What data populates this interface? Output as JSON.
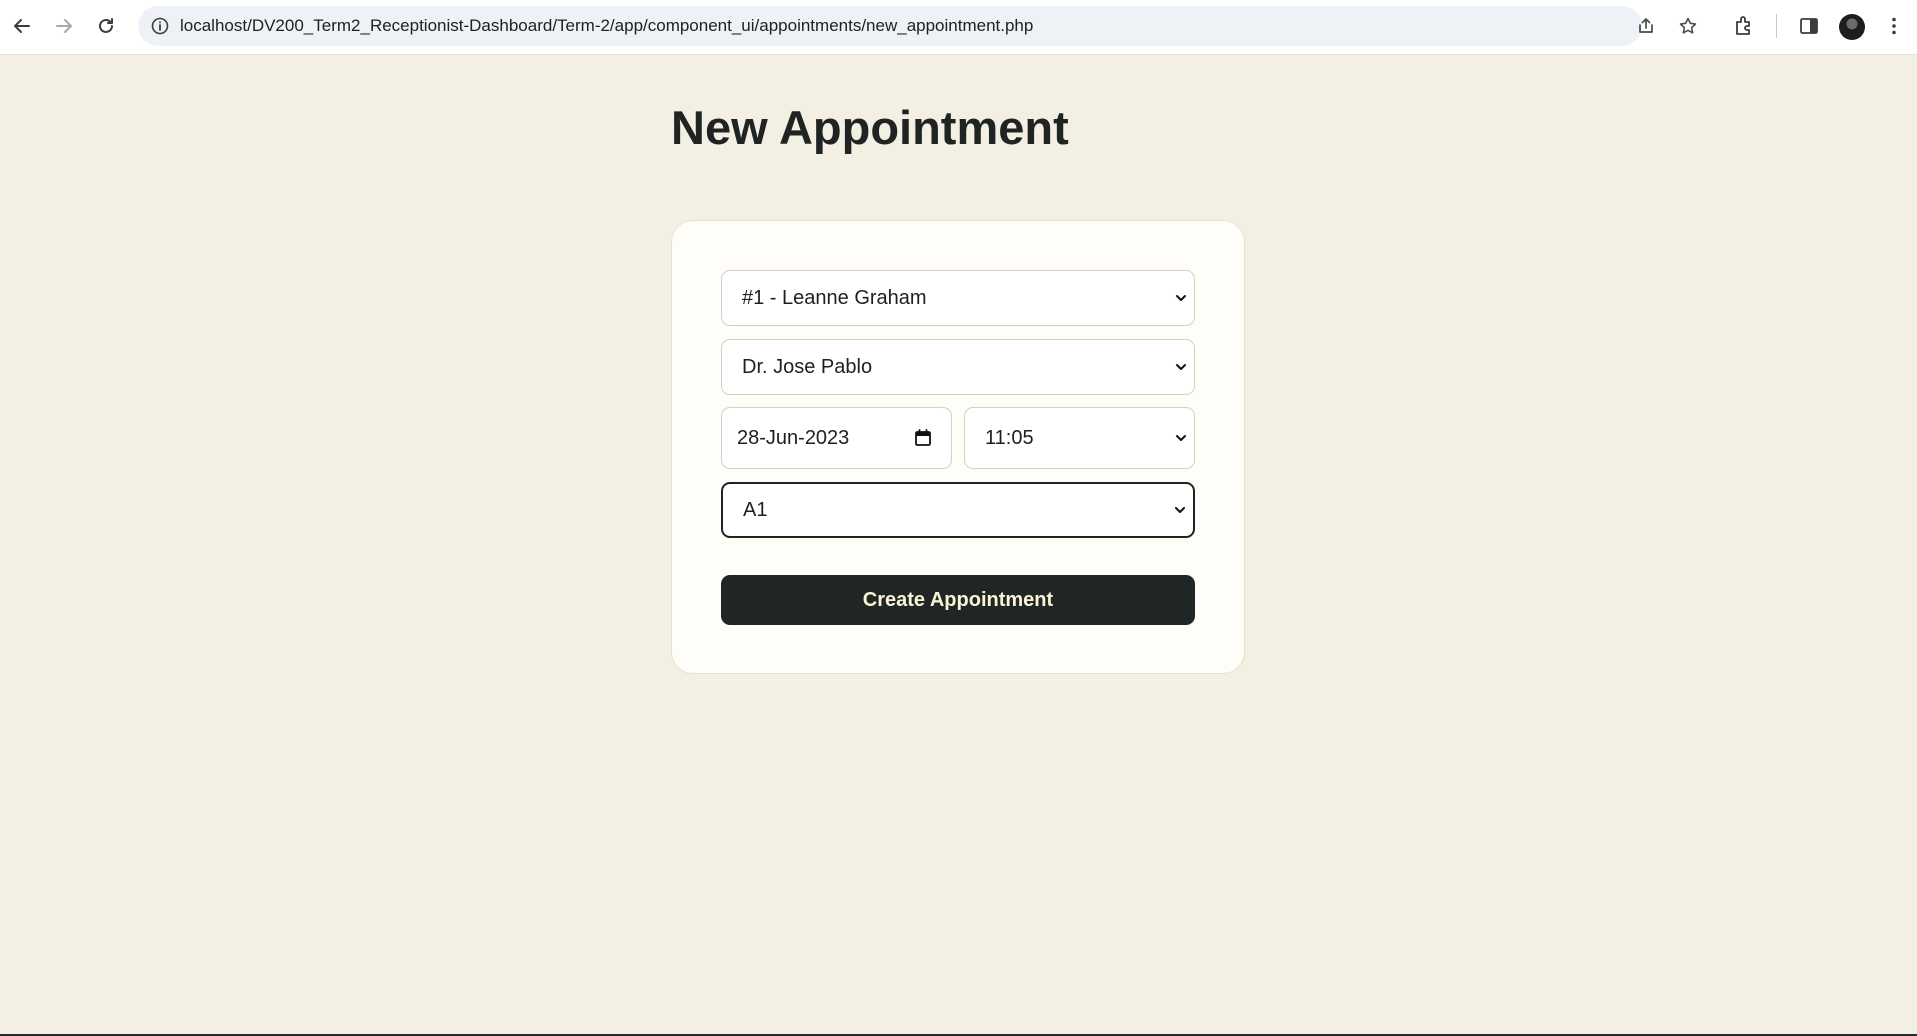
{
  "browser": {
    "url": "localhost/DV200_Term2_Receptionist-Dashboard/Term-2/app/component_ui/appointments/new_appointment.php"
  },
  "page": {
    "title": "New Appointment"
  },
  "form": {
    "patient_select": {
      "value": "#1 - Leanne Graham"
    },
    "doctor_select": {
      "value": "Dr. Jose Pablo"
    },
    "date_input": {
      "value": "28-Jun-2023"
    },
    "time_select": {
      "value": "11:05"
    },
    "room_select": {
      "value": "A1"
    },
    "submit_label": "Create Appointment"
  },
  "colors": {
    "background": "#f4efe3",
    "card": "#fffdf8",
    "button": "#1f2624",
    "button_text": "#faf3d8"
  }
}
